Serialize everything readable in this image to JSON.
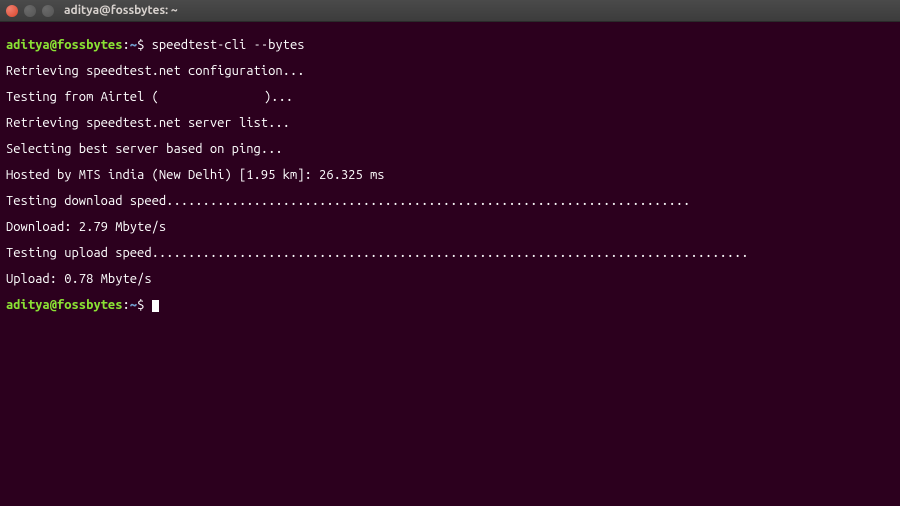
{
  "window": {
    "title": "aditya@fossbytes: ~"
  },
  "prompt": {
    "user": "aditya",
    "at": "@",
    "host": "fossbytes",
    "colon": ":",
    "path": "~",
    "dollar": "$"
  },
  "session": {
    "command1": "speedtest-cli --bytes",
    "out1": "Retrieving speedtest.net configuration...",
    "out2a": "Testing from Airtel (",
    "out2b": ")...",
    "out3": "Retrieving speedtest.net server list...",
    "out4": "Selecting best server based on ping...",
    "out5": "Hosted by MTS india (New Delhi) [1.95 km]: 26.325 ms",
    "out6": "Testing download speed........................................................................",
    "out7": "Download: 2.79 Mbyte/s",
    "out8": "Testing upload speed..................................................................................",
    "out9": "Upload: 0.78 Mbyte/s"
  }
}
